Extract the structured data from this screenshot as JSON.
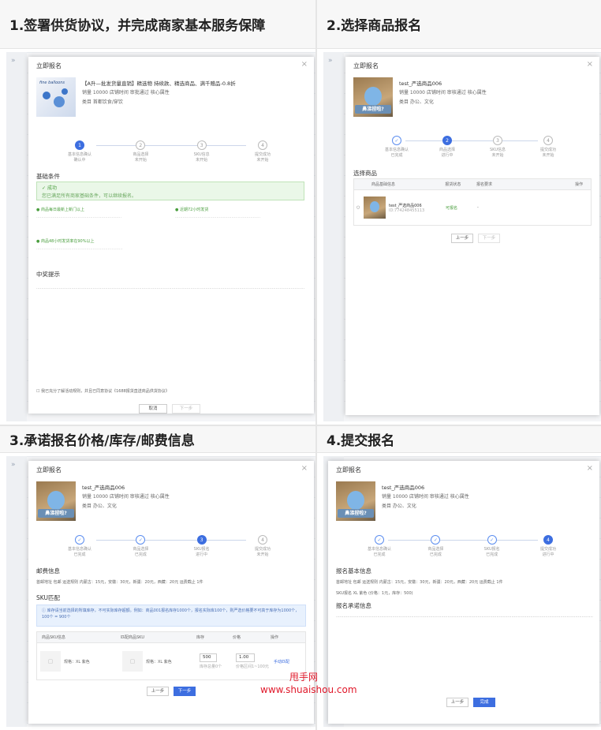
{
  "panels": [
    {
      "title": "1.签署供货协议，并完成商家基本服务保障"
    },
    {
      "title": "2.选择商品报名"
    },
    {
      "title": "3.承诺报名价格/库存/邮费信息"
    },
    {
      "title": "4.提交报名"
    }
  ],
  "modal_title": "立即报名",
  "p1": {
    "product": "【A升—批发货量直销】精选物 持续款、精选商品、满千赠品-0.8折",
    "row1": "销量  10000        店铺时间  审批通过        核心属性",
    "row2": "类目  首都饮食/穿饮",
    "img_caption": "fine balloons",
    "steps": [
      "基本信息确认",
      "商品选择",
      "SKU信息",
      "提交成功"
    ],
    "substeps": [
      "确认中",
      "未开始",
      "未开始",
      "未开始"
    ],
    "sec1": "基础条件",
    "success": "成功",
    "success_sub": "您已满足所有商家基础条件，可以继续报名。",
    "c1": "商品每日最新上新门以上",
    "c2": "近期72小时发货",
    "c3": "商品48小时发货率在90%以上",
    "sec2": "中奖提示",
    "agree": "我已充分了解活动规则，并且已同意协议《1688报货直送商品供货协议》",
    "cancel": "取消",
    "next": "下一步"
  },
  "p2": {
    "product": "test_严选商品006",
    "row1": "销量  10000        店铺时间  审核通过        核心属性",
    "row2": "类目  办公、文化",
    "img_caption": "鼻涕捏啦?",
    "steps": [
      "基本信息确认",
      "商品选择",
      "SKU信息",
      "提交成功"
    ],
    "substeps": [
      "已完成",
      "进行中",
      "未开始",
      "未开始"
    ],
    "sec": "选择商品",
    "cols": [
      "商品基础信息",
      "报货状态",
      "报名要求",
      "操作"
    ],
    "item": "test_严选商品006",
    "item_id": "ID:774248455113",
    "status": "可报名",
    "req": "-",
    "prev": "上一步",
    "next": "下一步"
  },
  "p3": {
    "product": "test_严选商品006",
    "row1": "销量  10000        店铺时间  审核通过        核心属性",
    "row2": "类目  办公、文化",
    "img_caption": "鼻涕捏啦?",
    "steps": [
      "基本信息确认",
      "商品选择",
      "SKU报名",
      "提交成功"
    ],
    "substeps": [
      "已完成",
      "已完成",
      "进行中",
      "未开始"
    ],
    "sec1": "邮费信息",
    "postage": "首邮地址  包邮      运送规则  内蒙古：15元，安徽：30元，新疆：20元，西藏：20元      运费截止  1件",
    "sec2": "SKU匹配",
    "notice": "库存请当前选择的所填库存，不可实际库存超额。例如：商品001报名库存1000个，报名实际库100个，则严选价格要不可高于库存为1000个，100个 = 900个",
    "cols": [
      "商品SKU信息",
      "匹配商品SKU",
      "库存",
      "价格",
      "操作"
    ],
    "sku1": "规格：XL 紫色",
    "sku2": "规格：XL 紫色",
    "stock": "500",
    "price": "1.00",
    "stock_hint": "库存总量0个",
    "price_hint": "价格区间1~100元",
    "op": "手动匹配",
    "prev": "上一步",
    "next": "下一步"
  },
  "p4": {
    "product": "test_严选商品006",
    "row1": "销量  10000        店铺时间  审核通过        核心属性",
    "row2": "类目  办公、文化",
    "img_caption": "鼻涕捏啦?",
    "steps": [
      "基本信息确认",
      "商品选择",
      "SKU报名",
      "提交成功"
    ],
    "substeps": [
      "已完成",
      "已完成",
      "已完成",
      "进行中"
    ],
    "sec1": "报名基本信息",
    "postage": "首邮地址  包邮      运送规则  内蒙古：15元，安徽：30元，新疆：20元，西藏：20元      运费截止  1件",
    "sku": "SKU报名  XL 紫色 (价格：1元，库存：500)",
    "sec2": "报名承诺信息",
    "prev": "上一步",
    "confirm": "完成"
  },
  "watermark": [
    "甩手网",
    "www.shuaishou.com"
  ]
}
